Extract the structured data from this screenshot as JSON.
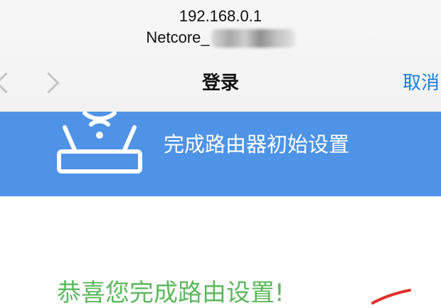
{
  "browser": {
    "address": "192.168.0.1",
    "ssid_prefix": "Netcore_",
    "nav_title": "登录",
    "cancel_label": "取消"
  },
  "banner": {
    "icon": "router-icon",
    "title": "完成路由器初始设置",
    "background_color": "#4e93e6"
  },
  "content": {
    "message": "恭喜您完成路由设置!",
    "message_color": "#5cb85c"
  }
}
